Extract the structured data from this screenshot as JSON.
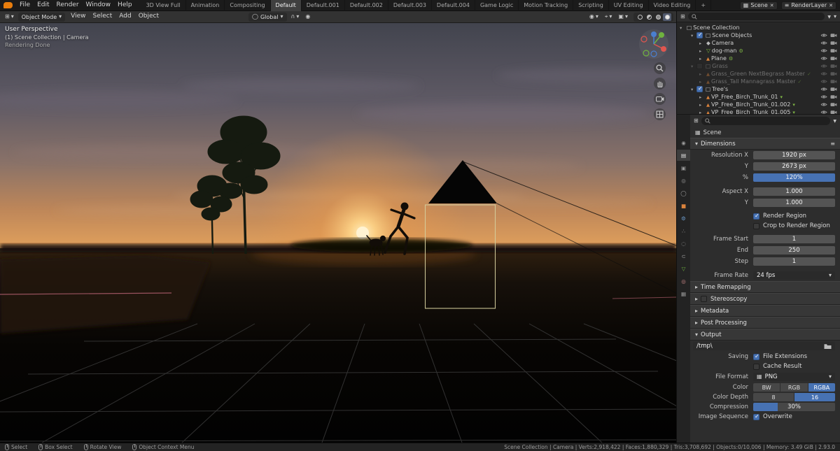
{
  "colors": {
    "accent": "#4772b3",
    "active_shading_highlight": "#50596d"
  },
  "topbar": {
    "menus": [
      "File",
      "Edit",
      "Render",
      "Window",
      "Help"
    ],
    "tabs": [
      {
        "label": "3D View Full"
      },
      {
        "label": "Animation"
      },
      {
        "label": "Compositing"
      },
      {
        "label": "Default",
        "active": true
      },
      {
        "label": "Default.001"
      },
      {
        "label": "Default.002"
      },
      {
        "label": "Default.003"
      },
      {
        "label": "Default.004"
      },
      {
        "label": "Game Logic"
      },
      {
        "label": "Motion Tracking"
      },
      {
        "label": "Scripting"
      },
      {
        "label": "UV Editing"
      },
      {
        "label": "Video Editing"
      },
      {
        "label": "+"
      }
    ],
    "scene_label": "Scene",
    "renderlayer_label": "RenderLayer"
  },
  "viewport": {
    "header": {
      "mode": "Object Mode",
      "menus": [
        "View",
        "Select",
        "Add",
        "Object"
      ],
      "orientation": "Global"
    },
    "overlay_lines": [
      "User Perspective",
      "(1) Scene Collection | Camera",
      "Rendering Done"
    ]
  },
  "outliner": {
    "root": "Scene Collection",
    "rows": [
      {
        "label": "Scene Objects",
        "depth": 1,
        "caret": "▾",
        "is_collection": true,
        "cb_checked": true,
        "icon": "collection"
      },
      {
        "label": "Camera",
        "depth": 2,
        "caret": "▸",
        "icon": "camera"
      },
      {
        "label": "dog-man",
        "depth": 2,
        "caret": "▸",
        "icon": "mesh-green",
        "extra": "⚙"
      },
      {
        "label": "Plane",
        "depth": 2,
        "caret": "▸",
        "icon": "mesh-orange",
        "extra": "⚙"
      },
      {
        "label": "Grass",
        "depth": 1,
        "caret": "▾",
        "is_collection": true,
        "cb_checked": false,
        "muted": true,
        "icon": "collection"
      },
      {
        "label": "Grass_Green NextBegrass Master",
        "depth": 2,
        "caret": "▸",
        "muted": true,
        "icon": "mesh-orange",
        "extra": "✓"
      },
      {
        "label": "Grass_Tall Mannagrass Master",
        "depth": 2,
        "caret": "▸",
        "muted": true,
        "icon": "mesh-orange",
        "extra": "✓"
      },
      {
        "label": "Tree's",
        "depth": 1,
        "caret": "▾",
        "is_collection": true,
        "cb_checked": true,
        "icon": "collection"
      },
      {
        "label": "VP_Free_Birch_Trunk_01",
        "depth": 2,
        "caret": "▸",
        "icon": "mesh-orange",
        "extra": "▾"
      },
      {
        "label": "VP_Free_Birch_Trunk_01.002",
        "depth": 2,
        "caret": "▸",
        "icon": "mesh-orange",
        "extra": "▾"
      },
      {
        "label": "VP_Free_Birch_Trunk_01.005",
        "depth": 2,
        "caret": "▸",
        "icon": "mesh-orange",
        "extra": "▾"
      }
    ]
  },
  "properties": {
    "context_label": "Scene",
    "tabs": [
      {
        "name": "render"
      },
      {
        "name": "output",
        "active": true
      },
      {
        "name": "view-layer"
      },
      {
        "name": "scene"
      },
      {
        "name": "world"
      },
      {
        "name": "object"
      },
      {
        "name": "modifiers"
      },
      {
        "name": "particles"
      },
      {
        "name": "physics"
      },
      {
        "name": "constraints"
      },
      {
        "name": "data"
      },
      {
        "name": "material"
      },
      {
        "name": "texture"
      }
    ],
    "dimensions": {
      "title": "Dimensions",
      "res_rows": [
        {
          "label": "Resolution X",
          "value": "1920 px"
        },
        {
          "label": "Y",
          "value": "2673 px"
        },
        {
          "label": "%",
          "value": "120%",
          "slider_full": true
        }
      ],
      "aspect_rows": [
        {
          "label": "Aspect X",
          "value": "1.000"
        },
        {
          "label": "Y",
          "value": "1.000"
        }
      ],
      "region_checks": [
        {
          "label": "Render Region",
          "checked": true
        },
        {
          "label": "Crop to Render Region",
          "checked": false
        }
      ],
      "frame_rows": [
        {
          "label": "Frame Start",
          "value": "1"
        },
        {
          "label": "End",
          "value": "250"
        },
        {
          "label": "Step",
          "value": "1"
        }
      ],
      "frame_rate": {
        "label": "Frame Rate",
        "value": "24 fps"
      }
    },
    "collapsed_sections": [
      {
        "label": "Time Remapping"
      },
      {
        "label": "Stereoscopy",
        "has_checkbox": true
      },
      {
        "label": "Metadata"
      },
      {
        "label": "Post Processing"
      }
    ],
    "output": {
      "title": "Output",
      "path": "/tmp\\",
      "saving_rows": [
        {
          "left_label": "Saving",
          "label": "File Extensions",
          "checked": true
        },
        {
          "left_label": "",
          "label": "Cache Result",
          "checked": false
        }
      ],
      "file_format": {
        "label": "File Format",
        "value": "PNG"
      },
      "color": {
        "label": "Color",
        "options": [
          {
            "label": "BW"
          },
          {
            "label": "RGB"
          },
          {
            "label": "RGBA",
            "active": true
          }
        ]
      },
      "color_depth": {
        "label": "Color Depth",
        "options": [
          {
            "label": "8"
          },
          {
            "label": "16",
            "active": true
          }
        ]
      },
      "compression": {
        "label": "Compression",
        "value": "30%"
      },
      "sequence_rows": [
        {
          "left_label": "Image Sequence",
          "label": "Overwrite",
          "checked": true
        }
      ]
    }
  },
  "statusbar": {
    "left": [
      {
        "label": "Select"
      },
      {
        "label": "Box Select"
      },
      {
        "label": "Rotate View"
      },
      {
        "label": "Object Context Menu"
      }
    ],
    "stats": "Scene Collection | Camera | Verts:2,918,422 | Faces:1,880,329 | Tris:3,708,692 | Objects:0/10,006 | Memory: 3.49 GiB | 2.93.0"
  }
}
